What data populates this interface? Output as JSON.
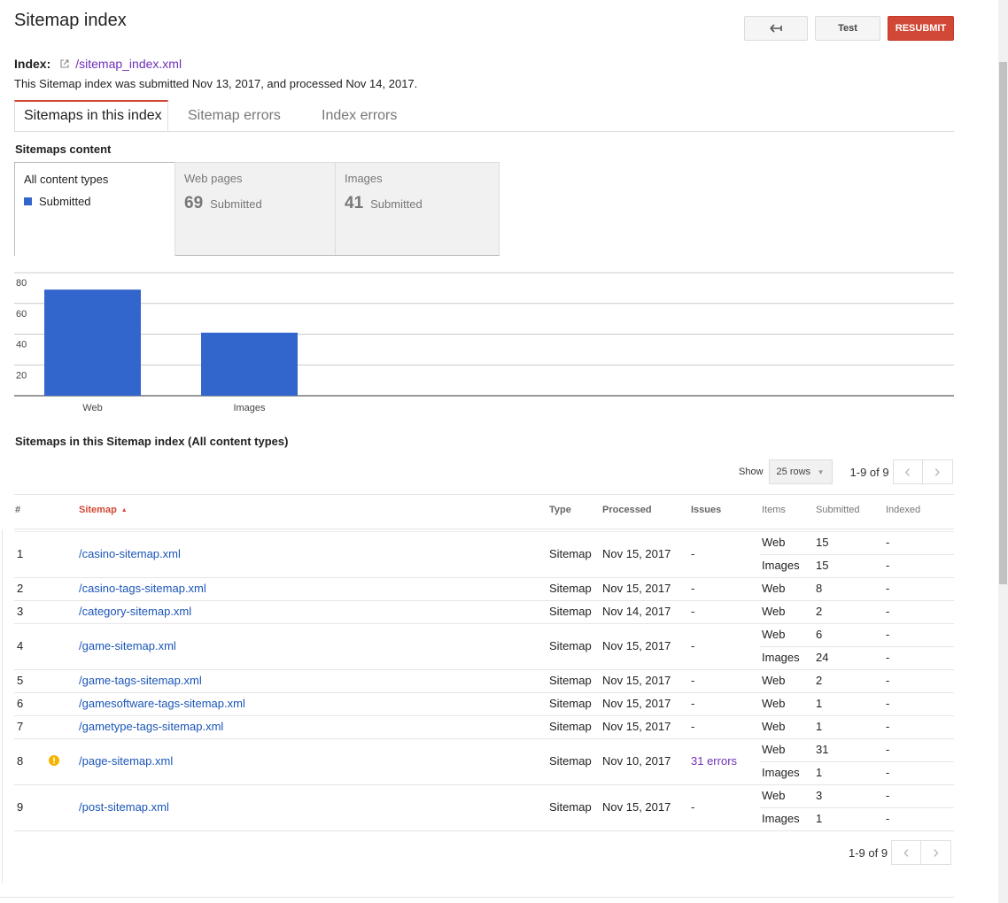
{
  "page_title": "Sitemap index",
  "toolbar": {
    "back_icon": "back-arrow-icon",
    "test_label": "Test",
    "resubmit_label": "RESUBMIT"
  },
  "index": {
    "label": "Index:",
    "link": "/sitemap_index.xml",
    "external_icon": "external-link-icon"
  },
  "summary": "This Sitemap index was submitted Nov 13, 2017, and processed Nov 14, 2017.",
  "tabs": [
    {
      "label": "Sitemaps in this index"
    },
    {
      "label": "Sitemap errors"
    },
    {
      "label": "Index errors"
    }
  ],
  "content_section": {
    "title": "Sitemaps content",
    "cards": [
      {
        "title": "All content types",
        "legend_label": "Submitted"
      },
      {
        "title": "Web pages",
        "count": "69",
        "count_label": "Submitted"
      },
      {
        "title": "Images",
        "count": "41",
        "count_label": "Submitted"
      }
    ]
  },
  "chart_data": {
    "type": "bar",
    "categories": [
      "Web",
      "Images"
    ],
    "values": [
      69,
      41
    ],
    "yticks": [
      20,
      40,
      60,
      80
    ],
    "ylim": [
      0,
      80
    ],
    "color": "#3366cc",
    "grid": true
  },
  "table_section": {
    "title": "Sitemaps in this Sitemap index (All content types)",
    "show_label": "Show",
    "rows_select": "25 rows",
    "range": "1-9 of 9",
    "columns": [
      "#",
      "Sitemap",
      "Type",
      "Processed",
      "Issues",
      "Items",
      "Submitted",
      "Indexed"
    ],
    "rows": [
      {
        "num": "1",
        "sitemap": "/casino-sitemap.xml",
        "type": "Sitemap",
        "processed": "Nov 15, 2017",
        "issues": "-",
        "warn": false,
        "items": [
          {
            "item": "Web",
            "submitted": "15",
            "indexed": "-"
          },
          {
            "item": "Images",
            "submitted": "15",
            "indexed": "-"
          }
        ]
      },
      {
        "num": "2",
        "sitemap": "/casino-tags-sitemap.xml",
        "type": "Sitemap",
        "processed": "Nov 15, 2017",
        "issues": "-",
        "warn": false,
        "items": [
          {
            "item": "Web",
            "submitted": "8",
            "indexed": "-"
          }
        ]
      },
      {
        "num": "3",
        "sitemap": "/category-sitemap.xml",
        "type": "Sitemap",
        "processed": "Nov 14, 2017",
        "issues": "-",
        "warn": false,
        "items": [
          {
            "item": "Web",
            "submitted": "2",
            "indexed": "-"
          }
        ]
      },
      {
        "num": "4",
        "sitemap": "/game-sitemap.xml",
        "type": "Sitemap",
        "processed": "Nov 15, 2017",
        "issues": "-",
        "warn": false,
        "items": [
          {
            "item": "Web",
            "submitted": "6",
            "indexed": "-"
          },
          {
            "item": "Images",
            "submitted": "24",
            "indexed": "-"
          }
        ]
      },
      {
        "num": "5",
        "sitemap": "/game-tags-sitemap.xml",
        "type": "Sitemap",
        "processed": "Nov 15, 2017",
        "issues": "-",
        "warn": false,
        "items": [
          {
            "item": "Web",
            "submitted": "2",
            "indexed": "-"
          }
        ]
      },
      {
        "num": "6",
        "sitemap": "/gamesoftware-tags-sitemap.xml",
        "type": "Sitemap",
        "processed": "Nov 15, 2017",
        "issues": "-",
        "warn": false,
        "items": [
          {
            "item": "Web",
            "submitted": "1",
            "indexed": "-"
          }
        ]
      },
      {
        "num": "7",
        "sitemap": "/gametype-tags-sitemap.xml",
        "type": "Sitemap",
        "processed": "Nov 15, 2017",
        "issues": "-",
        "warn": false,
        "items": [
          {
            "item": "Web",
            "submitted": "1",
            "indexed": "-"
          }
        ]
      },
      {
        "num": "8",
        "sitemap": "/page-sitemap.xml",
        "type": "Sitemap",
        "processed": "Nov 10, 2017",
        "issues": "31 errors",
        "warn": true,
        "items": [
          {
            "item": "Web",
            "submitted": "31",
            "indexed": "-"
          },
          {
            "item": "Images",
            "submitted": "1",
            "indexed": "-"
          }
        ]
      },
      {
        "num": "9",
        "sitemap": "/post-sitemap.xml",
        "type": "Sitemap",
        "processed": "Nov 15, 2017",
        "issues": "-",
        "warn": false,
        "items": [
          {
            "item": "Web",
            "submitted": "3",
            "indexed": "-"
          },
          {
            "item": "Images",
            "submitted": "1",
            "indexed": "-"
          }
        ]
      }
    ]
  }
}
